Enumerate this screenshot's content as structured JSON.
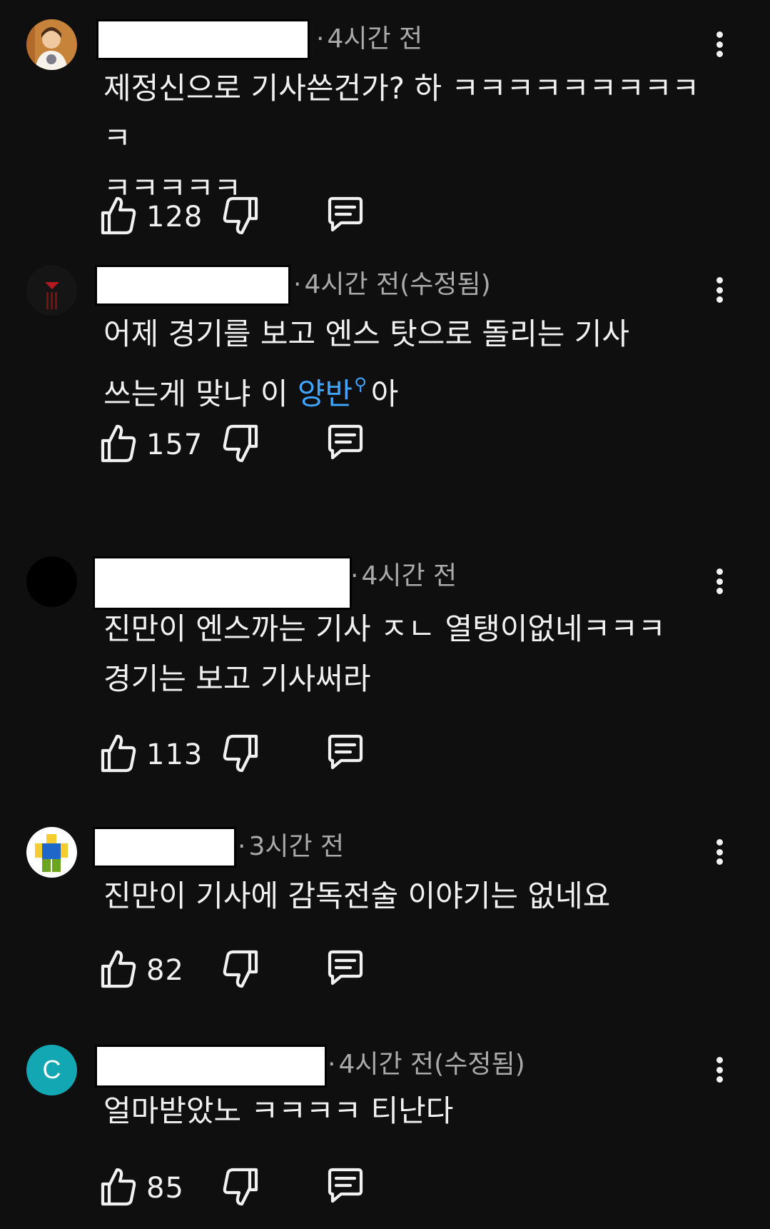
{
  "comments": [
    {
      "author_redacted": true,
      "avatar": "profile-photo-avatar",
      "time": "4시간 전",
      "edited": "",
      "text_parts": [
        "제정신으로 기사쓴건가? 하 ㅋㅋㅋㅋㅋㅋㅋㅋㅋㅋ\nㅋㅋㅋㅋㅋ",
        "",
        ""
      ],
      "likes": "128"
    },
    {
      "author_redacted": true,
      "avatar": "dark-logo-avatar",
      "time": "4시간 전",
      "edited": "(수정됨)",
      "text_parts": [
        "어제 경기를 보고 엔스 탓으로 돌리는 기사\n쓰는게 맞냐 이 ",
        "양반",
        "아"
      ],
      "search_mark": "⚲",
      "likes": "157"
    },
    {
      "author_redacted": true,
      "avatar": "black-avatar",
      "time": "4시간 전",
      "edited": "",
      "text_parts": [
        "진만이 엔스까는 기사 ㅈㄴ 열탱이없네ㅋㅋㅋ\n경기는 보고 기사써라",
        "",
        ""
      ],
      "likes": "113"
    },
    {
      "author_redacted": true,
      "avatar": "blocky-figure-avatar",
      "time": "3시간 전",
      "edited": "",
      "text_parts": [
        "진만이 기사에 감독전술 이야기는 없네요",
        "",
        ""
      ],
      "likes": "82"
    },
    {
      "author_redacted": true,
      "avatar": "letter-avatar",
      "avatar_letter": "C",
      "avatar_color": "#12a7b3",
      "time": "4시간 전",
      "edited": "(수정됨)",
      "text_parts": [
        "얼마받았노 ㅋㅋㅋㅋ 티난다",
        "",
        ""
      ],
      "likes": "85"
    }
  ],
  "separator": "·",
  "icons": {
    "like": "thumbs-up-icon",
    "dislike": "thumbs-down-icon",
    "reply": "reply-comment-icon",
    "menu": "more-vert-icon"
  },
  "colors": {
    "background": "#0f0f0f",
    "text": "#f1f1f1",
    "meta": "#aaaaaa",
    "link": "#3ea6ff"
  }
}
